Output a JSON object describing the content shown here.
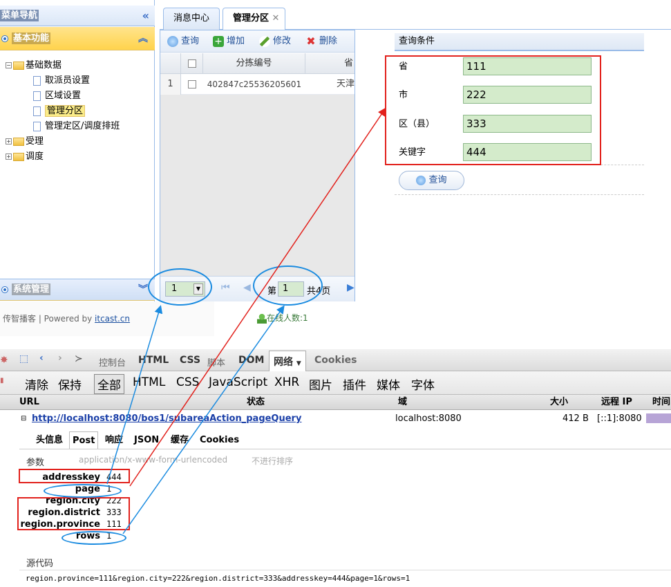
{
  "nav": {
    "header": "菜单导航",
    "basic_section": "基本功能",
    "system_section": "系统管理",
    "tree": {
      "root": "基础数据",
      "children": [
        "取派员设置",
        "区域设置",
        "管理分区",
        "管理定区/调度排班"
      ],
      "selected": "管理分区",
      "others": [
        "受理",
        "调度"
      ]
    }
  },
  "tabs": [
    {
      "label": "消息中心"
    },
    {
      "label": "管理分区",
      "closable": true
    }
  ],
  "toolbar": {
    "query": "查询",
    "add": "增加",
    "edit": "修改",
    "delete": "删除"
  },
  "grid": {
    "columns": [
      "分拣编号",
      "省"
    ],
    "rows": [
      {
        "index": "1",
        "code": "402847c25536205601",
        "province": "天津"
      }
    ]
  },
  "pager": {
    "page_size": "1",
    "page_prefix": "第",
    "page": "1",
    "page_total": "共4页"
  },
  "query_form": {
    "title": "查询条件",
    "fields": [
      {
        "label": "省",
        "value": "111"
      },
      {
        "label": "市",
        "value": "222"
      },
      {
        "label": "区（县）",
        "value": "333"
      },
      {
        "label": "关键字",
        "value": "444"
      }
    ],
    "button": "查询"
  },
  "footer": {
    "left_text": "传智播客 | Powered by ",
    "left_link": "itcast.cn",
    "online": "在线人数:1"
  },
  "devtools": {
    "main_tabs": [
      "控制台",
      "HTML",
      "CSS",
      "脚本",
      "DOM",
      "网络",
      "Cookies"
    ],
    "active_main_tab": "网络",
    "filters": [
      "清除",
      "保持",
      "全部",
      "HTML",
      "CSS",
      "JavaScript",
      "XHR",
      "图片",
      "插件",
      "媒体",
      "字体"
    ],
    "columns": [
      "URL",
      "状态",
      "域",
      "大小",
      "远程 IP",
      "时间"
    ],
    "request": {
      "url": "http://localhost:8080/bos1/subareaAction_pageQuery",
      "domain": "localhost:8080",
      "size": "412 B",
      "remote_ip": "[::1]:8080"
    },
    "sub_tabs": [
      "头信息",
      "Post",
      "响应",
      "JSON",
      "缓存",
      "Cookies"
    ],
    "active_sub_tab": "Post",
    "params_label": "参数",
    "content_type": "application/x-www-form-urlencoded",
    "no_sort": "不进行排序",
    "params": [
      {
        "key": "addresskey",
        "value": "444"
      },
      {
        "key": "page",
        "value": "1"
      },
      {
        "key": "region.city",
        "value": "222"
      },
      {
        "key": "region.district",
        "value": "333"
      },
      {
        "key": "region.province",
        "value": "111"
      },
      {
        "key": "rows",
        "value": "1"
      }
    ],
    "source_label": "源代码",
    "source": "region.province=111&region.city=222&region.district=333&addresskey=444&page=1&rows=1"
  },
  "colors": {
    "annotation_red": "#e2211c",
    "annotation_blue": "#1a8be0"
  }
}
